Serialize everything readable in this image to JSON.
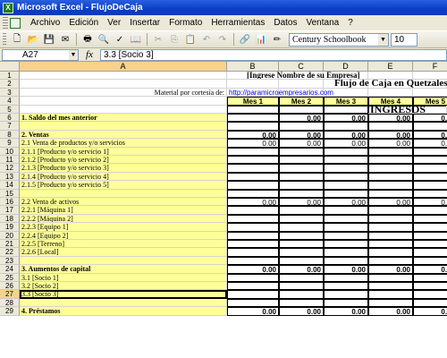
{
  "window": {
    "title": "Microsoft Excel - FlujoDeCaja"
  },
  "menu": [
    "Archivo",
    "Edición",
    "Ver",
    "Insertar",
    "Formato",
    "Herramientas",
    "Datos",
    "Ventana",
    "?"
  ],
  "toolbar": {
    "font": "Century Schoolbook",
    "size": "10"
  },
  "formula": {
    "cell_ref": "A27",
    "content": "3.3  [Socio 3]"
  },
  "columns": [
    "A",
    "B",
    "C",
    "D",
    "E",
    "F"
  ],
  "sheet": {
    "title1": "[Ingrese Nombre de su Empresa]",
    "title2": "Flujo de Caja en Quetzales",
    "courtesy": "Material por cortesía de:",
    "link": "http://paramicroempresarios.com",
    "months": [
      "Mes 1",
      "Mes 2",
      "Mes 3",
      "Mes 4",
      "Mes 5"
    ],
    "ingresos": "INGRESOS",
    "zero": "0.00",
    "rows": [
      {
        "n": "1",
        "a": ""
      },
      {
        "n": "2",
        "a": ""
      },
      {
        "n": "3",
        "a": ""
      },
      {
        "n": "4",
        "a": ""
      },
      {
        "n": "5",
        "a": ""
      },
      {
        "n": "6",
        "a": "1. Saldo del mes anterior"
      },
      {
        "n": "7",
        "a": ""
      },
      {
        "n": "8",
        "a": "2. Ventas"
      },
      {
        "n": "9",
        "a": "2.1  Venta de productos y/o servicios"
      },
      {
        "n": "10",
        "a": "2.1.1  [Producto y/o servicio 1]"
      },
      {
        "n": "11",
        "a": "2.1.2  [Producto y/o servicio 2]"
      },
      {
        "n": "12",
        "a": "2.1.3  [Producto y/o servicio 3]"
      },
      {
        "n": "13",
        "a": "2.1.4  [Producto y/o servicio 4]"
      },
      {
        "n": "14",
        "a": "2.1.5  [Producto y/o servicio 5]"
      },
      {
        "n": "15",
        "a": ""
      },
      {
        "n": "16",
        "a": "2.2  Venta de activos"
      },
      {
        "n": "17",
        "a": "2.2.1  [Máquina 1]"
      },
      {
        "n": "18",
        "a": "2.2.2  [Máquina 2]"
      },
      {
        "n": "19",
        "a": "2.2.3  [Equipo 1]"
      },
      {
        "n": "20",
        "a": "2.2.4  [Equipo 2]"
      },
      {
        "n": "21",
        "a": "2.2.5  [Terreno]"
      },
      {
        "n": "22",
        "a": "2.2.6  [Local]"
      },
      {
        "n": "23",
        "a": ""
      },
      {
        "n": "24",
        "a": "3. Aumentos de capital"
      },
      {
        "n": "25",
        "a": "3.1  [Socio 1]"
      },
      {
        "n": "26",
        "a": "3.2  [Socio 2]"
      },
      {
        "n": "27",
        "a": "3.3  [Socio 3]"
      },
      {
        "n": "28",
        "a": ""
      },
      {
        "n": "29",
        "a": "4. Préstamos"
      }
    ]
  }
}
